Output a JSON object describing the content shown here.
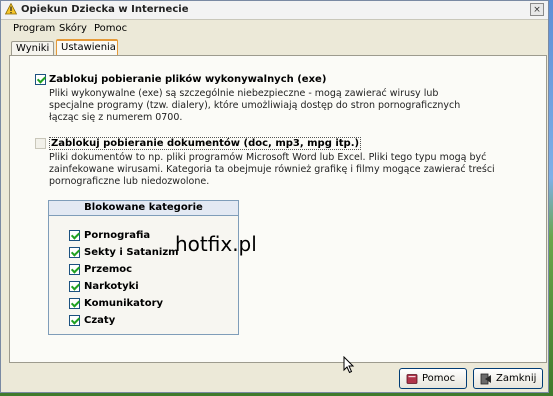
{
  "window": {
    "title": "Opiekun Dziecka w Internecie",
    "close_symbol": "×"
  },
  "menu": [
    "Program",
    "Skóry",
    "Pomoc"
  ],
  "tabs": [
    {
      "label": "Wyniki",
      "active": false
    },
    {
      "label": "Ustawienia",
      "active": true
    }
  ],
  "option_exe": {
    "checked": true,
    "label": "Zablokuj pobieranie plików wykonywalnych (exe)",
    "description": [
      "Pliki wykonywalne (exe) są szczególnie niebezpieczne - mogą zawierać wirusy lub",
      "specjalne programy (tzw. dialery), które umożliwiają dostęp do stron pornograficznych",
      "łącząc się z numerem 0700."
    ]
  },
  "option_docs": {
    "checked": false,
    "label": "Zablokuj pobieranie dokumentów (doc, mp3, mpg itp.)",
    "description": [
      "Pliki dokumentów to np. pliki programów Microsoft Word lub Excel. Pliki tego typu mogą być",
      "zainfekowane wirusami. Kategoria ta obejmuje również grafikę i filmy mogące zawierać treści",
      "pornograficzne lub niedozwolone."
    ]
  },
  "categories": {
    "header": "Blokowane kategorie",
    "items": [
      {
        "label": "Pornografia",
        "checked": true
      },
      {
        "label": "Sekty i Satanizm",
        "checked": true
      },
      {
        "label": "Przemoc",
        "checked": true
      },
      {
        "label": "Narkotyki",
        "checked": true
      },
      {
        "label": "Komunikatory",
        "checked": true
      },
      {
        "label": "Czaty",
        "checked": true
      }
    ]
  },
  "watermark": "hotfix.pl",
  "buttons": {
    "help": "Pomoc",
    "close": "Zamknij"
  },
  "icons": {
    "app": "warning-triangle-icon",
    "help": "book-icon",
    "close": "exit-door-icon"
  }
}
